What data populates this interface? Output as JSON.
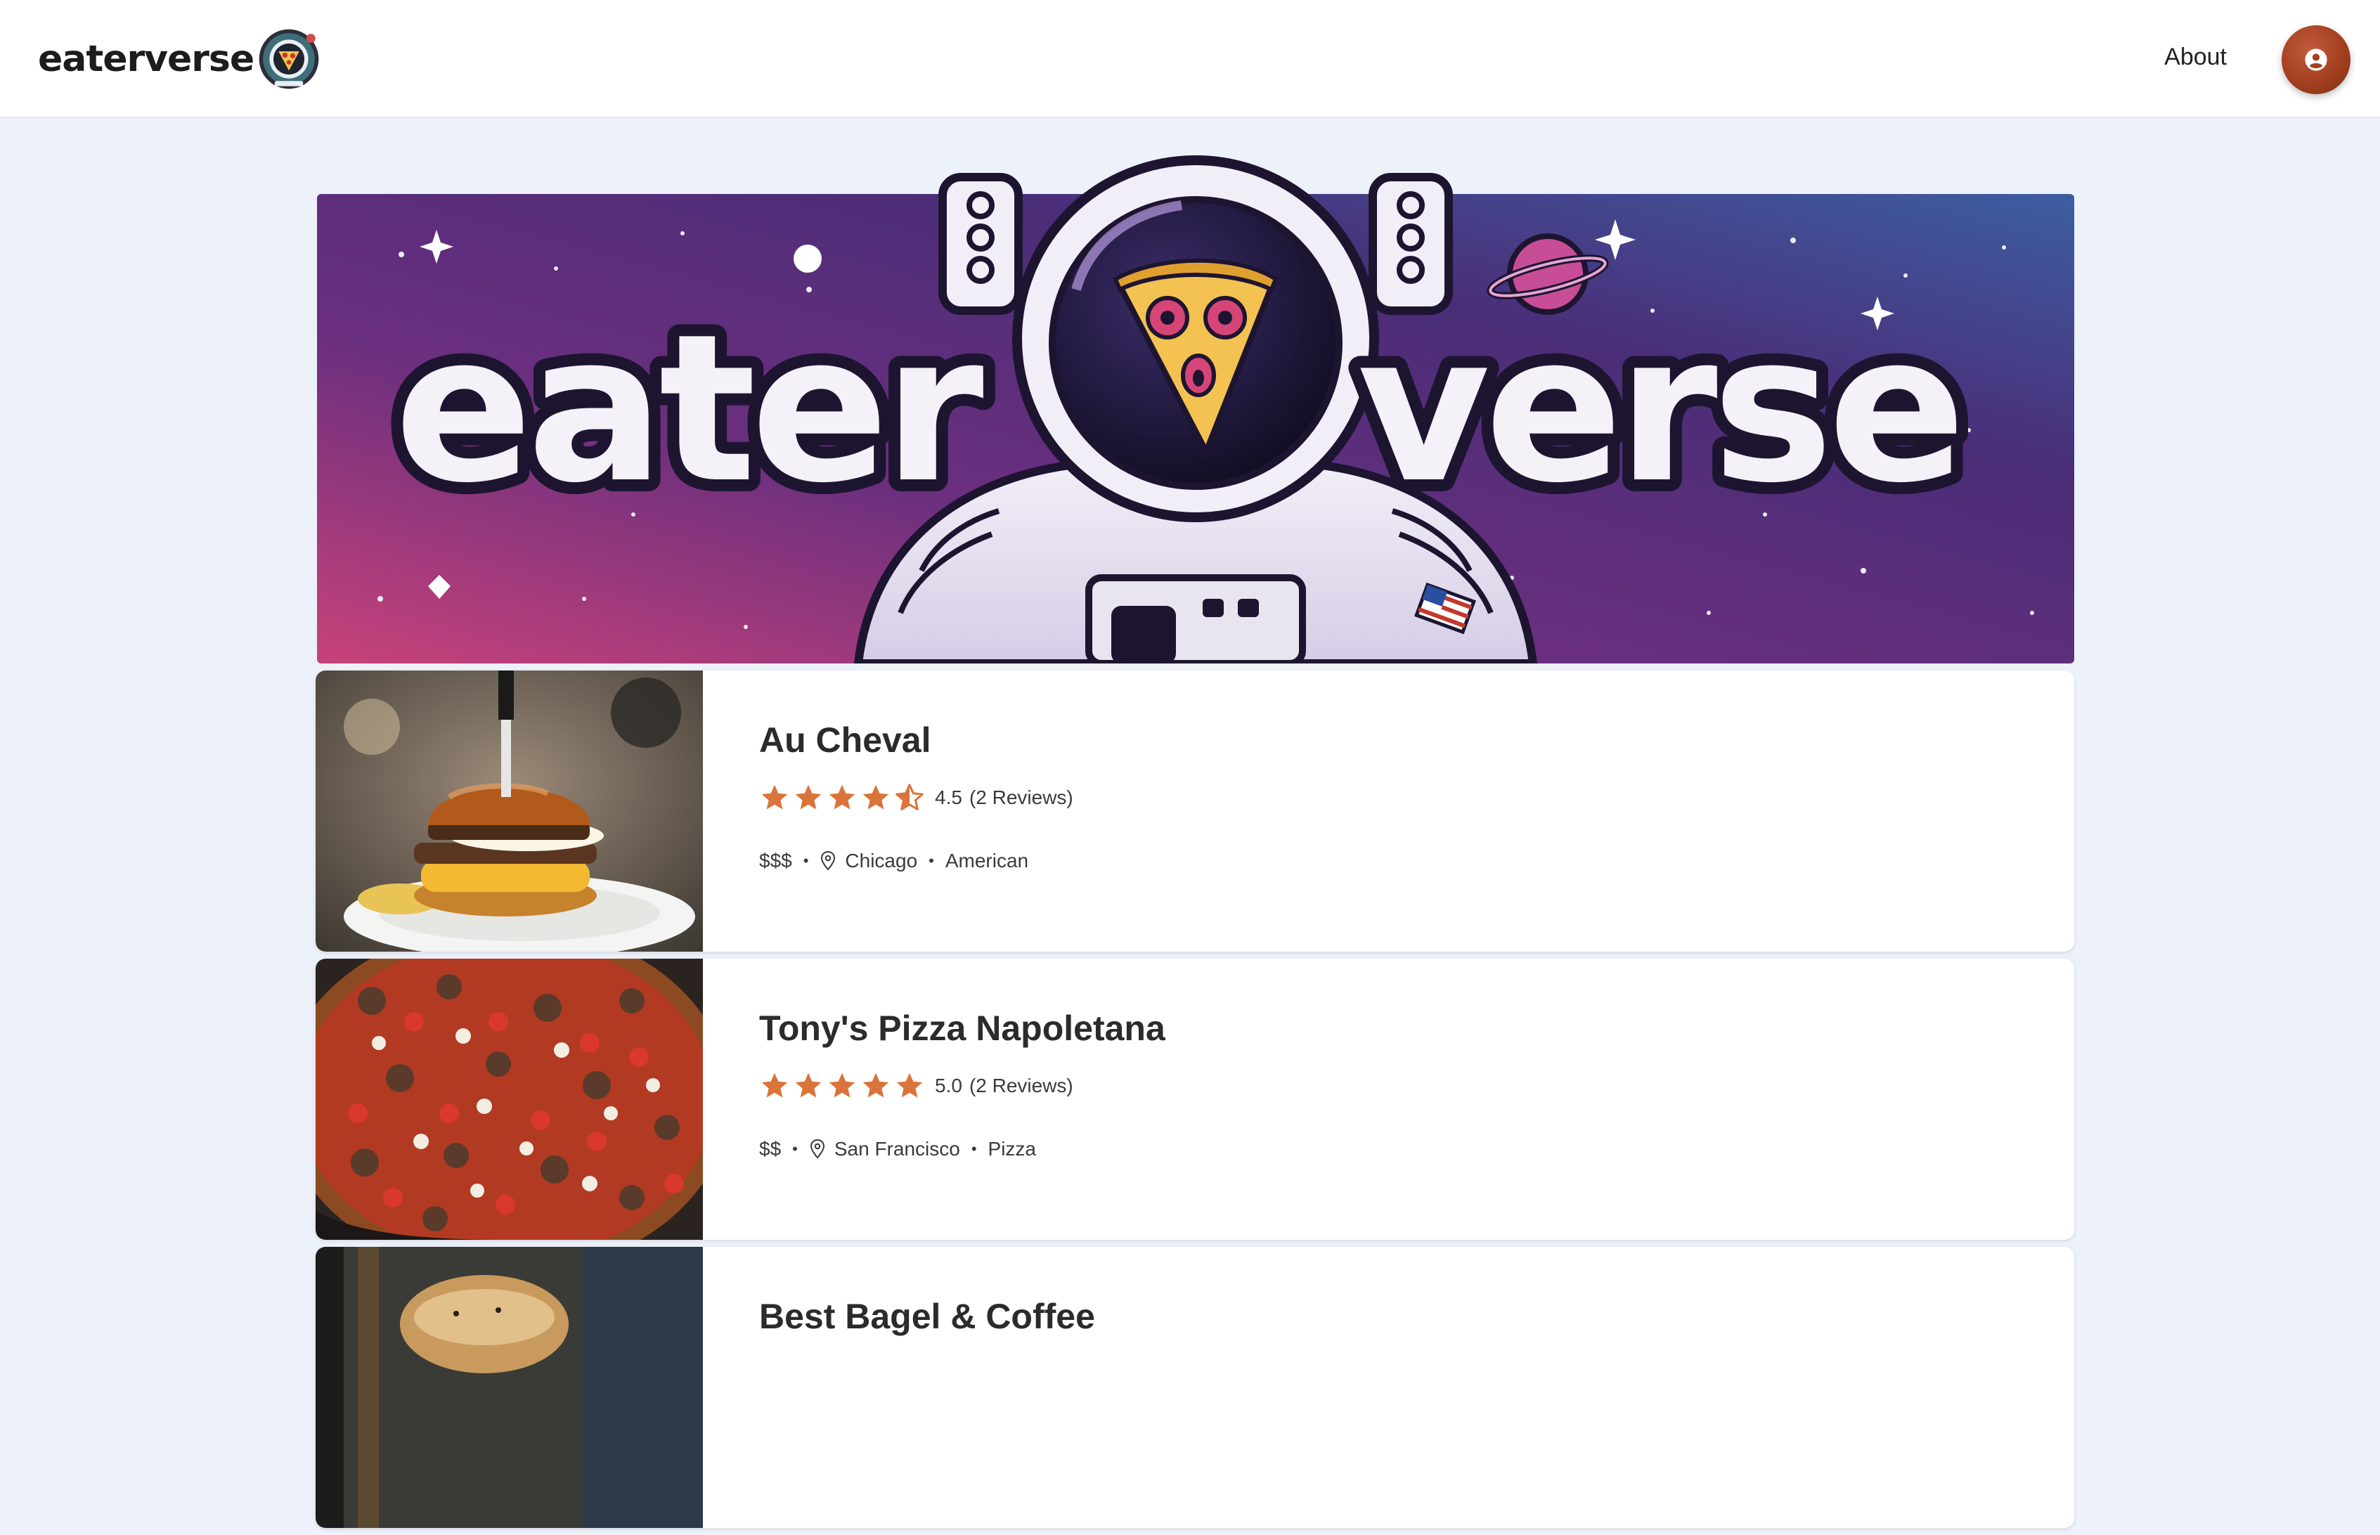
{
  "header": {
    "brand_name": "eaterverse",
    "about_label": "About"
  },
  "icons": {
    "brand_badge": "pizza-astronaut-logo-icon",
    "avatar": "user-icon",
    "star": "star-icon",
    "location": "location-pin-icon"
  },
  "hero": {
    "title_left": "eater",
    "title_right": "verse"
  },
  "colors": {
    "accent_star": "#d9743a",
    "avatar": "#a3401f",
    "hero_sky_top": "#3a2c6e",
    "hero_sky_bottom": "#c8427a"
  },
  "restaurants": [
    {
      "name": "Au Cheval",
      "rating": "4.5",
      "rating_value": 4.5,
      "reviews": "(2 Reviews)",
      "price": "$$$",
      "city": "Chicago",
      "cuisine": "American"
    },
    {
      "name": "Tony's Pizza Napoletana",
      "rating": "5.0",
      "rating_value": 5.0,
      "reviews": "(2 Reviews)",
      "price": "$$",
      "city": "San Francisco",
      "cuisine": "Pizza"
    },
    {
      "name": "Best Bagel & Coffee"
    }
  ]
}
